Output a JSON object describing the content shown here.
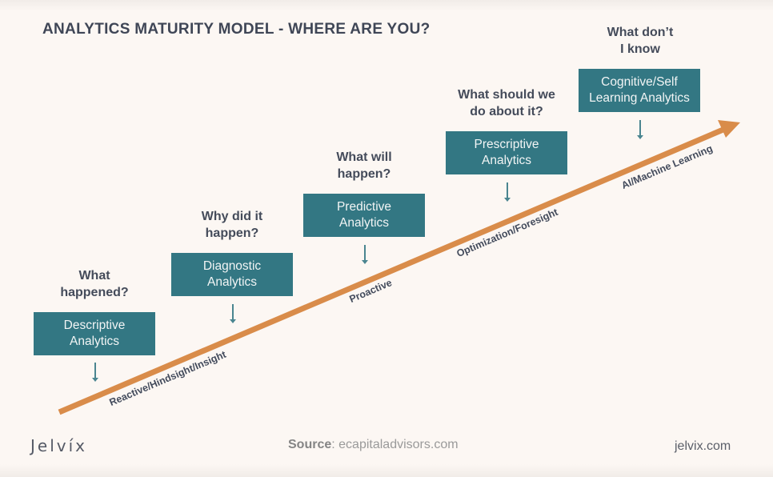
{
  "title": "ANALYTICS MATURITY MODEL - WHERE ARE YOU?",
  "colors": {
    "box": "#337783",
    "arrow": "#d98c4a",
    "text_dark": "#3f4656",
    "background": "#fcf7f3"
  },
  "steps": [
    {
      "question_l1": "What",
      "question_l2": "happened?",
      "box_l1": "Descriptive",
      "box_l2": "Analytics"
    },
    {
      "question_l1": "Why did it",
      "question_l2": "happen?",
      "box_l1": "Diagnostic",
      "box_l2": "Analytics"
    },
    {
      "question_l1": "What will",
      "question_l2": "happen?",
      "box_l1": "Predictive",
      "box_l2": "Analytics"
    },
    {
      "question_l1": "What should we",
      "question_l2": "do about it?",
      "box_l1": "Prescriptive",
      "box_l2": "Analytics"
    },
    {
      "question_l1": "What don’t",
      "question_l2": "I know",
      "box_l1": "Cognitive/Self",
      "box_l2": "Learning Analytics"
    }
  ],
  "arrow_labels": [
    "Reactive/Hindsight/Insight",
    "Proactive",
    "Optimization/Foresight",
    "AI/Machine Learning"
  ],
  "footer": {
    "logo": "Jelvíx",
    "source_label": "Source",
    "source_value": ": ecapitaladvisors.com",
    "site": "jelvix.com"
  }
}
